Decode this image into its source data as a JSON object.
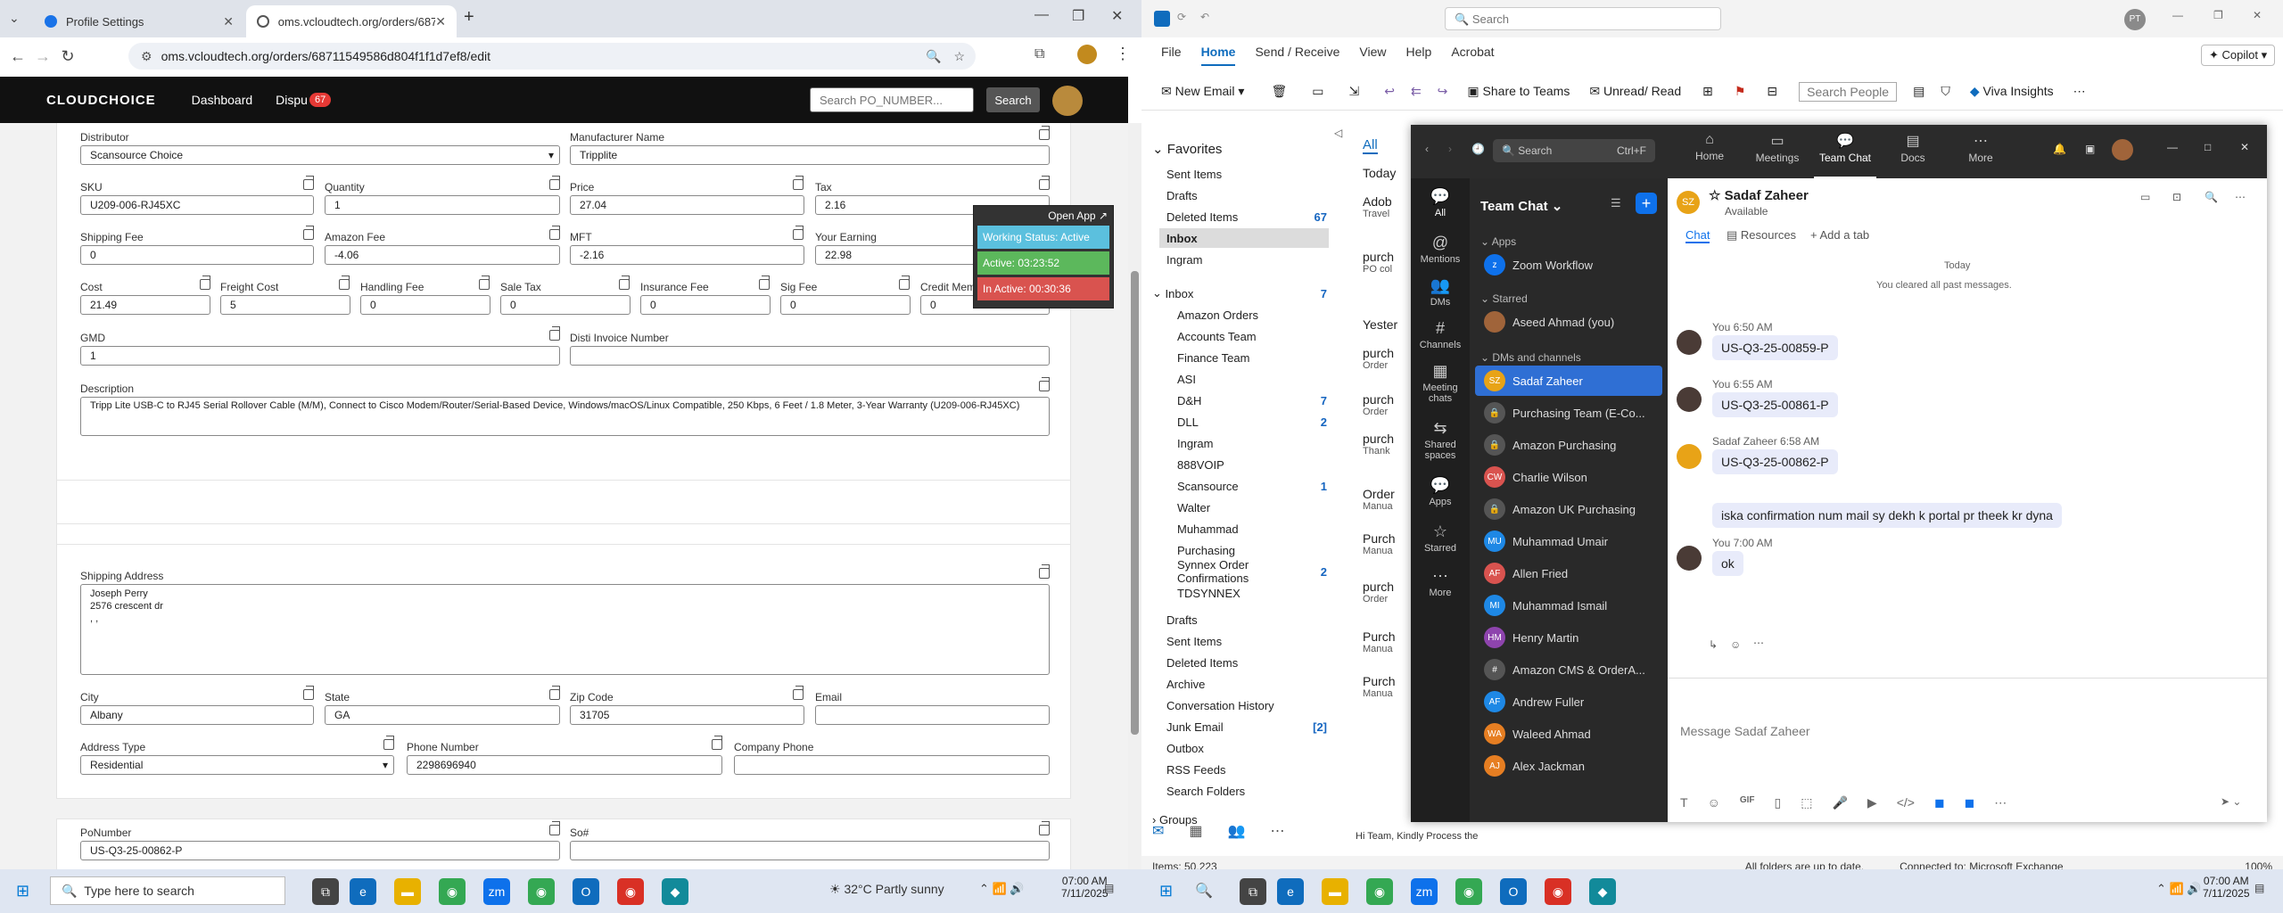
{
  "chrome": {
    "tabs": [
      {
        "label": "Profile Settings"
      },
      {
        "label": "oms.vcloudtech.org/orders/687"
      }
    ],
    "url": "oms.vcloudtech.org/orders/68711549586d804f1f1d7ef8/edit"
  },
  "app": {
    "logo": "CLOUDCHOICE",
    "nav": {
      "dashboard": "Dashboard",
      "dispute": "Dispu",
      "badge": "67"
    },
    "search_placeholder": "Search PO_NUMBER...",
    "search_button": "Search"
  },
  "order": {
    "distributor_label": "Distributor",
    "distributor": "Scansource Choice",
    "manufacturer_label": "Manufacturer Name",
    "manufacturer": "Tripplite",
    "sku_label": "SKU",
    "sku": "U209-006-RJ45XC",
    "qty_label": "Quantity",
    "qty": "1",
    "price_label": "Price",
    "price": "27.04",
    "tax_label": "Tax",
    "tax": "2.16",
    "shipfee_label": "Shipping Fee",
    "shipfee": "0",
    "amzfee_label": "Amazon Fee",
    "amzfee": "-4.06",
    "mft_label": "MFT",
    "mft": "-2.16",
    "earning_label": "Your Earning",
    "earning": "22.98",
    "cost_label": "Cost",
    "cost": "21.49",
    "freight_label": "Freight Cost",
    "freight": "5",
    "handling_label": "Handling Fee",
    "handling": "0",
    "saletax_label": "Sale Tax",
    "saletax": "0",
    "insurance_label": "Insurance Fee",
    "insurance": "0",
    "sig_label": "Sig Fee",
    "sig": "0",
    "credit_label": "Credit Mem",
    "credit": "0",
    "gmd_label": "GMD",
    "gmd": "1",
    "invoice_label": "Disti Invoice Number",
    "invoice": "",
    "desc_label": "Description",
    "desc": "Tripp Lite USB-C to RJ45 Serial Rollover Cable (M/M), Connect to Cisco Modem/Router/Serial-Based Device, Windows/macOS/Linux Compatible, 250 Kbps, 6 Feet / 1.8 Meter, 3-Year Warranty (U209-006-RJ45XC)",
    "shipaddr_label": "Shipping Address",
    "addr1": "Joseph Perry",
    "addr2": "2576 crescent dr",
    "addr3": ", ,",
    "city_label": "City",
    "city": "Albany",
    "state_label": "State",
    "state": "GA",
    "zip_label": "Zip Code",
    "zip": "31705",
    "email_label": "Email",
    "email": "",
    "addrtype_label": "Address Type",
    "addrtype": "Residential",
    "phone_label": "Phone Number",
    "phone": "2298696940",
    "cphone_label": "Company Phone",
    "cphone": "",
    "po_label": "PoNumber",
    "po": "US-Q3-25-00862-P",
    "so_label": "So#"
  },
  "status_widget": {
    "open_app": "Open App",
    "working": "Working Status: Active",
    "active": "Active: 03:23:52",
    "inactive": "In Active: 00:30:36",
    "colors": {
      "working": "#5bc0de",
      "active": "#5cb85c",
      "inactive": "#d9534f"
    }
  },
  "outlook": {
    "search": "Search",
    "copilot": "Copilot",
    "menu": [
      "File",
      "Home",
      "Send / Receive",
      "View",
      "Help",
      "Acrobat"
    ],
    "ribbon": {
      "new_email": "New Email",
      "share": "Share to Teams",
      "unread": "Unread/ Read",
      "search_people": "Search People",
      "viva": "Viva Insights"
    },
    "favorites_label": "Favorites",
    "favorites": [
      {
        "name": "Sent Items",
        "count": ""
      },
      {
        "name": "Drafts",
        "count": ""
      },
      {
        "name": "Deleted Items",
        "count": "67"
      },
      {
        "name": "Inbox",
        "count": ""
      },
      {
        "name": "Ingram",
        "count": ""
      }
    ],
    "inbox_label": "Inbox",
    "inbox_count": "7",
    "folders": [
      {
        "name": "Amazon Orders",
        "count": ""
      },
      {
        "name": "Accounts Team",
        "count": ""
      },
      {
        "name": "Finance Team",
        "count": ""
      },
      {
        "name": "ASI",
        "count": ""
      },
      {
        "name": "D&H",
        "count": "7"
      },
      {
        "name": "DLL",
        "count": "2"
      },
      {
        "name": "Ingram",
        "count": ""
      },
      {
        "name": "888VOIP",
        "count": ""
      },
      {
        "name": "Scansource",
        "count": "1"
      },
      {
        "name": "Walter",
        "count": ""
      },
      {
        "name": "Muhammad",
        "count": ""
      },
      {
        "name": "Purchasing",
        "count": ""
      },
      {
        "name": "Synnex Order Confirmations",
        "count": "2"
      },
      {
        "name": "TDSYNNEX",
        "count": ""
      }
    ],
    "root_folders": [
      {
        "name": "Drafts",
        "count": ""
      },
      {
        "name": "Sent Items",
        "count": ""
      },
      {
        "name": "Deleted Items",
        "count": ""
      },
      {
        "name": "Archive",
        "count": ""
      },
      {
        "name": "Conversation History",
        "count": ""
      },
      {
        "name": "Junk Email",
        "count": "[2]"
      },
      {
        "name": "Outbox",
        "count": ""
      },
      {
        "name": "RSS Feeds",
        "count": ""
      },
      {
        "name": "Search Folders",
        "count": ""
      }
    ],
    "groups": "Groups",
    "list_tab": "All",
    "list": [
      {
        "a": "Today",
        "b": ""
      },
      {
        "a": "Adob",
        "b": "Travel"
      },
      {
        "a": "purch",
        "b": "PO col"
      },
      {
        "a": "Yester",
        "b": ""
      },
      {
        "a": "purch",
        "b": "Order"
      },
      {
        "a": "purch",
        "b": "Order"
      },
      {
        "a": "purch",
        "b": "Thank"
      },
      {
        "a": "Order",
        "b": "Manua"
      },
      {
        "a": "Purch",
        "b": "Manua"
      },
      {
        "a": "purch",
        "b": "Order"
      },
      {
        "a": "Purch",
        "b": "Manua"
      },
      {
        "a": "Purch",
        "b": "Manua"
      }
    ],
    "preview": "Hi Team,  Kindly Process the",
    "status": {
      "items": "Items: 50,223",
      "sync": "All folders are up to date.",
      "conn": "Connected to: Microsoft Exchange",
      "zoom": "100%"
    }
  },
  "teams": {
    "search": "Search",
    "shortcut": "Ctrl+F",
    "topnav": [
      {
        "label": "Home"
      },
      {
        "label": "Meetings"
      },
      {
        "label": "Team Chat"
      },
      {
        "label": "Docs"
      },
      {
        "label": "More"
      }
    ],
    "rail": [
      {
        "label": "All"
      },
      {
        "label": "Mentions"
      },
      {
        "label": "DMs"
      },
      {
        "label": "Channels"
      },
      {
        "label": "Meeting chats"
      },
      {
        "label": "Shared spaces"
      },
      {
        "label": "Apps"
      },
      {
        "label": "Starred"
      },
      {
        "label": "More"
      }
    ],
    "list_title": "Team Chat",
    "apps_label": "Apps",
    "zoom_workflow": "Zoom Workflow",
    "starred_label": "Starred",
    "me": "Aseed Ahmad (you)",
    "dms_label": "DMs and channels",
    "contacts": [
      {
        "name": "Sadaf Zaheer",
        "ini": "SZ",
        "color": "#e8a317"
      },
      {
        "name": "Purchasing Team (E-Co...",
        "ini": "🔒",
        "color": "#555"
      },
      {
        "name": "Amazon Purchasing",
        "ini": "🔒",
        "color": "#555"
      },
      {
        "name": "Charlie Wilson",
        "ini": "CW",
        "color": "#d9534f"
      },
      {
        "name": "Amazon UK Purchasing",
        "ini": "🔒",
        "color": "#555"
      },
      {
        "name": "Muhammad Umair",
        "ini": "MU",
        "color": "#1e88e5"
      },
      {
        "name": "Allen Fried",
        "ini": "AF",
        "color": "#d9534f"
      },
      {
        "name": "Muhammad Ismail",
        "ini": "MI",
        "color": "#1e88e5"
      },
      {
        "name": "Henry Martin",
        "ini": "HM",
        "color": "#8e44ad"
      },
      {
        "name": "Amazon CMS & OrderA...",
        "ini": "#",
        "color": "#555"
      },
      {
        "name": "Andrew Fuller",
        "ini": "AF",
        "color": "#1e88e5"
      },
      {
        "name": "Waleed Ahmad",
        "ini": "WA",
        "color": "#e67e22"
      },
      {
        "name": "Alex Jackman",
        "ini": "AJ",
        "color": "#e67e22"
      }
    ],
    "contact_name": "Sadaf Zaheer",
    "contact_status": "Available",
    "tabs": {
      "chat": "Chat",
      "resources": "Resources",
      "add": "Add a tab"
    },
    "day": "Today",
    "cleared": "You cleared all past messages.",
    "messages": [
      {
        "meta": "You 6:50 AM",
        "text": "US-Q3-25-00859-P"
      },
      {
        "meta": "You 6:55 AM",
        "text": "US-Q3-25-00861-P"
      },
      {
        "meta": "Sadaf Zaheer 6:58 AM",
        "text": "US-Q3-25-00862-P"
      },
      {
        "meta": "",
        "text": "iska confirmation num mail sy dekh k portal pr theek kr dyna"
      },
      {
        "meta": "You 7:00 AM",
        "text": "ok"
      }
    ],
    "compose_placeholder": "Message Sadaf Zaheer"
  },
  "taskbar": {
    "search": "Type here to search",
    "weather": "32°C  Partly sunny",
    "time": "07:00 AM",
    "date": "7/11/2025"
  }
}
